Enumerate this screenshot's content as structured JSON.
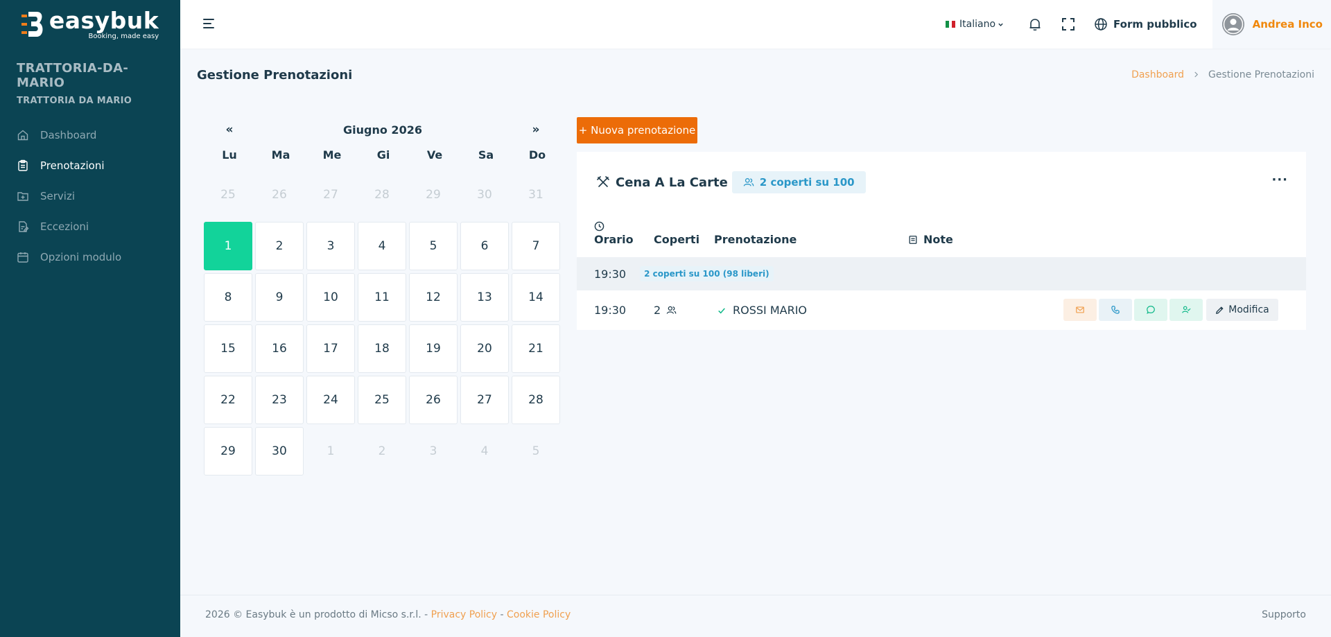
{
  "brand": {
    "name": "easybuk",
    "tagline": "Booking, made easy"
  },
  "org": {
    "title": "TRATTORIA-DA-MARIO",
    "subtitle": "TRATTORIA DA MARIO"
  },
  "sidebar": {
    "items": [
      {
        "label": "Dashboard",
        "icon": "home-icon"
      },
      {
        "label": "Prenotazioni",
        "icon": "clipboard-icon",
        "active": true
      },
      {
        "label": "Servizi",
        "icon": "folder-plus-icon"
      },
      {
        "label": "Eccezioni",
        "icon": "document-edit-icon"
      },
      {
        "label": "Opzioni modulo",
        "icon": "calendar-icon"
      }
    ]
  },
  "topbar": {
    "language": "Italiano",
    "public_form": "Form pubblico",
    "user_name": "Andrea Inco"
  },
  "page": {
    "title": "Gestione Prenotazioni",
    "breadcrumb": [
      "Dashboard",
      "Gestione Prenotazioni"
    ]
  },
  "calendar": {
    "month": "Giugno 2026",
    "prev": "«",
    "next": "»",
    "weekdays": [
      "Lu",
      "Ma",
      "Me",
      "Gi",
      "Ve",
      "Sa",
      "Do"
    ],
    "weeks": [
      [
        "25",
        "26",
        "27",
        "28",
        "29",
        "30",
        "31"
      ],
      [
        "1",
        "2",
        "3",
        "4",
        "5",
        "6",
        "7"
      ],
      [
        "8",
        "9",
        "10",
        "11",
        "12",
        "13",
        "14"
      ],
      [
        "15",
        "16",
        "17",
        "18",
        "19",
        "20",
        "21"
      ],
      [
        "22",
        "23",
        "24",
        "25",
        "26",
        "27",
        "28"
      ],
      [
        "29",
        "30",
        "1",
        "2",
        "3",
        "4",
        "5"
      ]
    ],
    "selected_day": "1"
  },
  "actions": {
    "new_booking": "+ Nuova prenotazione"
  },
  "service": {
    "name": "Cena A La Carte",
    "capacity": "2 coperti su 100",
    "more": "···",
    "columns": {
      "time": "Orario",
      "covers": "Coperti",
      "booking": "Prenotazione",
      "notes": "Note"
    },
    "group": {
      "time": "19:30",
      "availability": "2 coperti su 100 (98 liberi)"
    },
    "reservations": [
      {
        "time": "19:30",
        "covers": "2",
        "name": "ROSSI MARIO",
        "edit_label": "Modifica"
      }
    ]
  },
  "footer": {
    "copyright": "2026 © Easybuk è un prodotto di Micso s.r.l. - ",
    "privacy": "Privacy Policy",
    "sep": " - ",
    "cookie": "Cookie Policy",
    "support": "Supporto"
  },
  "colors": {
    "sidebar_bg": "#0b4453",
    "accent_orange": "#ec6c08",
    "selected_day": "#12d39a",
    "info_blue": "#2a97c8"
  }
}
